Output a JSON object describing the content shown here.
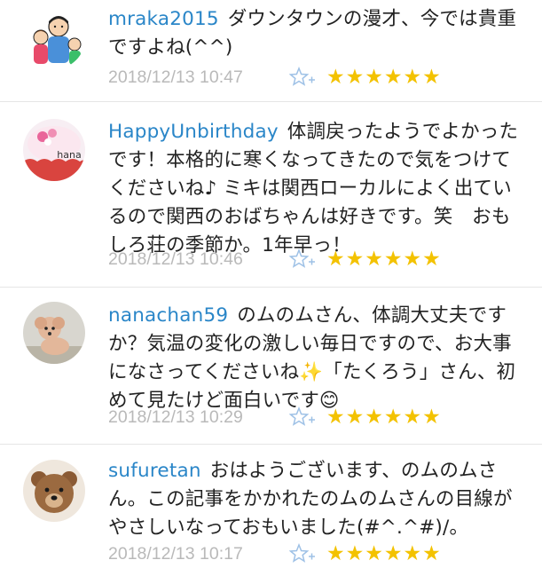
{
  "comments": [
    {
      "username": "mraka2015",
      "text": "ダウンタウンの漫才、今では貴重ですよね(^^)",
      "timestamp": "2018/12/13 10:47",
      "stars": "★★★★★★"
    },
    {
      "username": "HappyUnbirthday",
      "text": "体調戻ったようでよかったです！本格的に寒くなってきたので気をつけてくださいね♪ ミキは関西ローカルによく出ているので関西のおばちゃんは好きです。笑　おもしろ荘の季節か。1年早っ！",
      "timestamp": "2018/12/13 10:46",
      "stars": "★★★★★★",
      "avatar_label": "hana"
    },
    {
      "username": "nanachan59",
      "text": "のムのムさん、体調大丈夫ですか？気温の変化の激しい毎日ですので、お大事になさってくださいね✨「たくろう」さん、初めて見たけど面白いです😊",
      "timestamp": "2018/12/13 10:29",
      "stars": "★★★★★★"
    },
    {
      "username": "sufuretan",
      "text": "おはようございます、のムのムさん。この記事をかかれたのムのムさんの目線がやさしいなっておもいました(#^.^#)/。",
      "timestamp": "2018/12/13 10:17",
      "stars": "★★★★★★"
    }
  ],
  "colors": {
    "username": "#2a86c8",
    "timestamp": "#b9b9b9",
    "star": "#f3c200"
  }
}
